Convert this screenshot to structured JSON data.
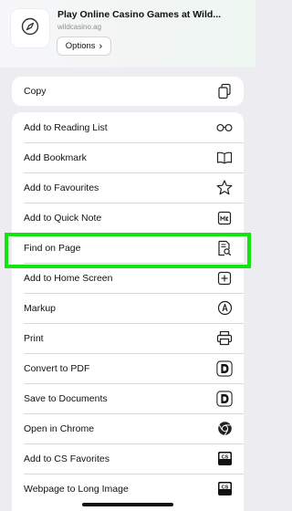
{
  "header": {
    "title": "Play Online Casino Games at Wild...",
    "domain": "wildcasino.ag",
    "options_label": "Options",
    "options_chevron": "›",
    "thumb_icon": "compass-icon"
  },
  "copy_action": {
    "label": "Copy",
    "icon": "copy-icon"
  },
  "actions": [
    {
      "label": "Add to Reading List",
      "icon": "glasses-icon"
    },
    {
      "label": "Add Bookmark",
      "icon": "book-icon"
    },
    {
      "label": "Add to Favourites",
      "icon": "star-icon"
    },
    {
      "label": "Add to Quick Note",
      "icon": "quick-note-icon"
    },
    {
      "label": "Find on Page",
      "icon": "find-page-icon"
    },
    {
      "label": "Add to Home Screen",
      "icon": "add-square-icon"
    },
    {
      "label": "Markup",
      "icon": "markup-icon"
    },
    {
      "label": "Print",
      "icon": "printer-icon"
    },
    {
      "label": "Convert to PDF",
      "icon": "pdf-app-icon"
    },
    {
      "label": "Save to Documents",
      "icon": "documents-app-icon"
    },
    {
      "label": "Open in Chrome",
      "icon": "chrome-icon"
    },
    {
      "label": "Add to CS Favorites",
      "icon": "cs-app-icon"
    },
    {
      "label": "Webpage to Long Image",
      "icon": "cs-app-icon"
    }
  ],
  "colors": {
    "highlight": "#12e40f",
    "background": "#ececf1",
    "card": "#ffffff"
  }
}
